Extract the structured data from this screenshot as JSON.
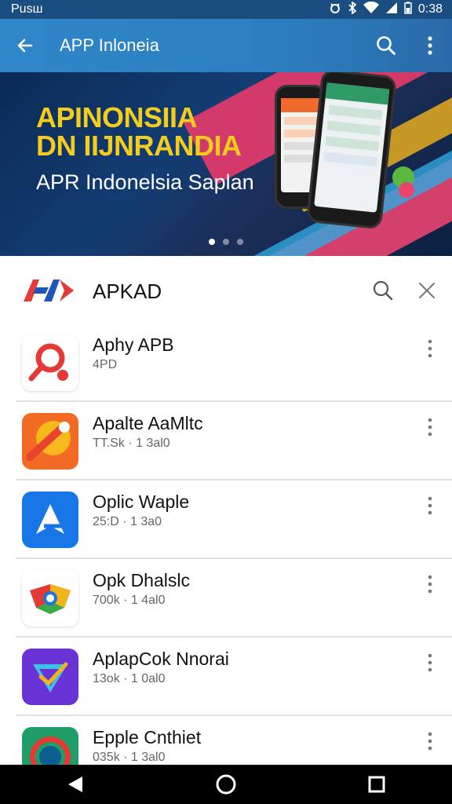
{
  "status_bar": {
    "left_text": "Pusш",
    "time": "0:38"
  },
  "app_bar": {
    "title": "APP Inloneia"
  },
  "banner": {
    "headline_line1": "APINONSIIA",
    "headline_line2": "DN IIJNRANDIA",
    "subtitle": "APR Indonelsia Saplan",
    "slide_count": 3,
    "active_slide": 1
  },
  "search": {
    "title": "APKAD"
  },
  "apps": [
    {
      "name": "Aphy APB",
      "meta": "4PD"
    },
    {
      "name": "Apalte AaMltc",
      "meta": "TT.Sk · 1 3al0"
    },
    {
      "name": "Oplic Waple",
      "meta": "25:D · 1 3a0"
    },
    {
      "name": "Opk Dhalslc",
      "meta": "700k · 1 4al0"
    },
    {
      "name": "AplapCok Nnorai",
      "meta": "13ok · 1 0al0"
    },
    {
      "name": "Epple Cnthiet",
      "meta": "035k · 1 3al0"
    }
  ],
  "colors": {
    "accent": "#2f86c8",
    "banner_text": "#f4cc1d"
  }
}
